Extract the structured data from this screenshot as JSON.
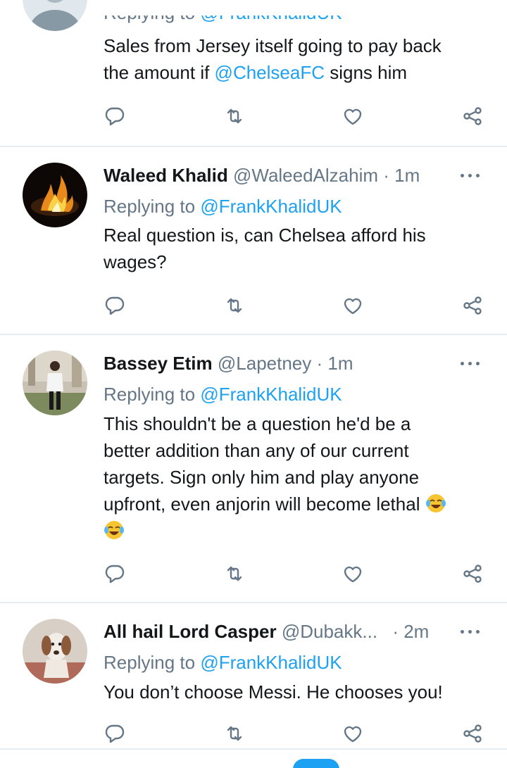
{
  "tweets": [
    {
      "id": "t0",
      "name": "",
      "handle": "",
      "time": "",
      "replying_prefix": "Replying to ",
      "replying_handle": "@FrankKhalidUK",
      "body": [
        {
          "text": "Sales from Jersey itself going to pay back"
        },
        {
          "text": "the amount if ",
          "mention": "@ChelseaFC",
          "after": " signs him"
        }
      ]
    },
    {
      "id": "t1",
      "name": "Waleed Khalid",
      "handle": "@WaleedAlzahim",
      "time": "· 1m",
      "replying_prefix": "Replying to ",
      "replying_handle": "@FrankKhalidUK",
      "body": [
        {
          "text": "Real question is, can Chelsea afford his"
        },
        {
          "text": "wages?"
        }
      ]
    },
    {
      "id": "t2",
      "name": "Bassey Etim",
      "handle": "@Lapetney",
      "time": "· 1m",
      "replying_prefix": "Replying to ",
      "replying_handle": "@FrankKhalidUK",
      "body": [
        {
          "text": "This shouldn't be a question he'd be a"
        },
        {
          "text": "better addition  than any of our current"
        },
        {
          "text": "targets. Sign only him and play anyone"
        },
        {
          "text": "upfront, even anjorin will become lethal"
        }
      ],
      "emojis": [
        "face-with-tears-of-joy",
        "face-with-tears-of-joy"
      ]
    },
    {
      "id": "t3",
      "name": "All hail Lord Casper",
      "handle": "@Dubakk...",
      "time": "· 2m",
      "replying_prefix": "Replying to ",
      "replying_handle": "@FrankKhalidUK",
      "body": [
        {
          "text": "You don’t choose Messi. He chooses you!"
        }
      ]
    }
  ],
  "icons": {
    "reply": "reply-icon",
    "retweet": "retweet-icon",
    "like": "like-icon",
    "share": "share-icon",
    "more": "more-icon"
  },
  "colors": {
    "name": "#14171a",
    "muted": "#657786",
    "link": "#1da1f2",
    "divider": "#e6ecf0"
  }
}
